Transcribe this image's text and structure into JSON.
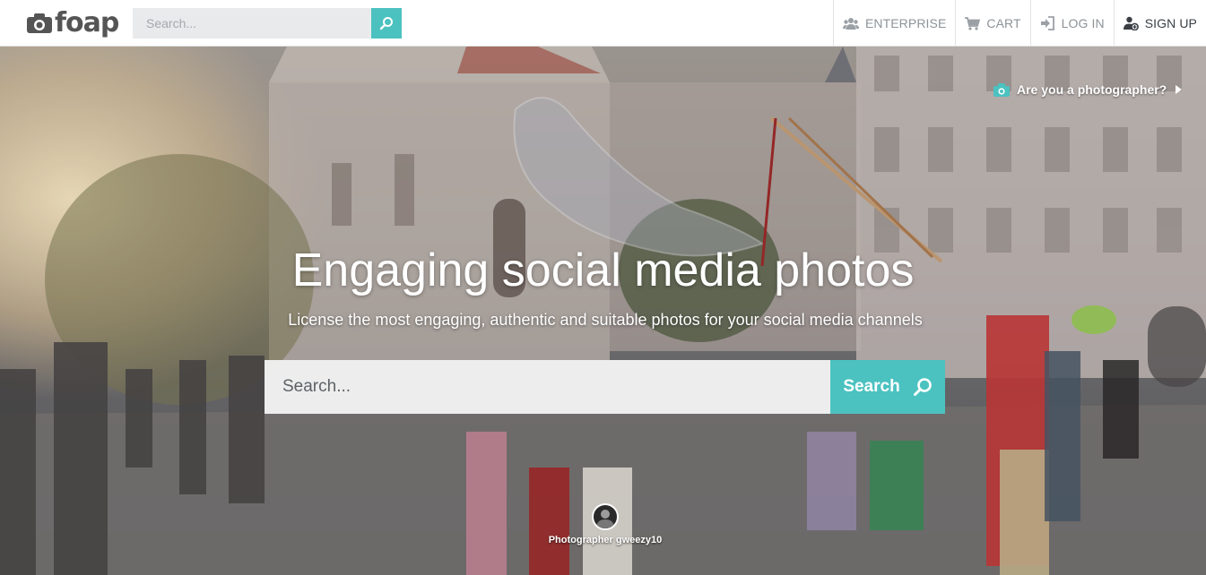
{
  "header": {
    "logo_text": "foap",
    "search_placeholder": "Search...",
    "nav": {
      "enterprise": "ENTERPRISE",
      "cart": "CART",
      "login": "LOG IN",
      "signup": "SIGN UP"
    }
  },
  "hero": {
    "photographer_link": "Are you a photographer?",
    "title": "Engaging social media photos",
    "subtitle": "License the most engaging, authentic and suitable photos for your social media channels",
    "search_placeholder": "Search...",
    "search_button": "Search",
    "credit": "Photographer gweezy10"
  },
  "colors": {
    "accent": "#4bc2c0",
    "nav_text": "#8d9398"
  },
  "icons": [
    "camera-icon",
    "search-icon",
    "users-icon",
    "cart-icon",
    "login-icon",
    "user-add-icon",
    "play-triangle-icon"
  ]
}
